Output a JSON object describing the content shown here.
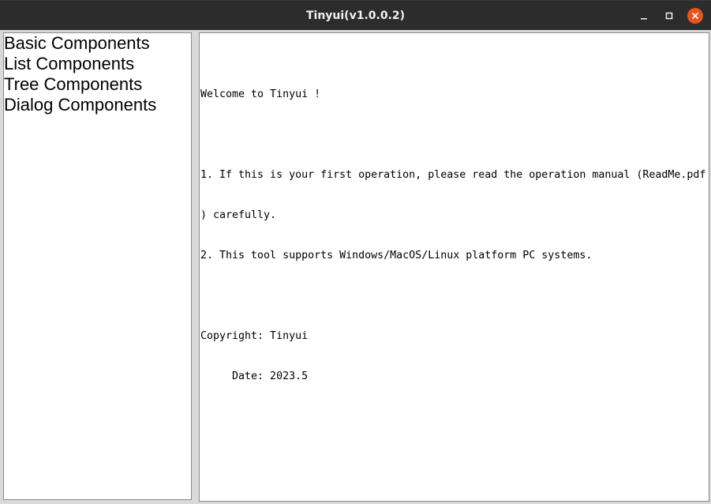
{
  "window": {
    "title": "Tinyui(v1.0.0.2)",
    "controls": {
      "minimize": "minimize-icon",
      "maximize": "maximize-icon",
      "close": "close-icon"
    },
    "accent_color": "#e95420"
  },
  "sidebar": {
    "items": [
      {
        "label": "Basic Components"
      },
      {
        "label": "List Components"
      },
      {
        "label": "Tree Components"
      },
      {
        "label": "Dialog Components"
      }
    ]
  },
  "content": {
    "lines": [
      "Welcome to Tinyui !",
      "",
      "1. If this is your first operation, please read the operation manual (ReadMe.pdf",
      ") carefully.",
      "2. This tool supports Windows/MacOS/Linux platform PC systems.",
      "",
      "Copyright: Tinyui",
      "     Date: 2023.5"
    ]
  }
}
